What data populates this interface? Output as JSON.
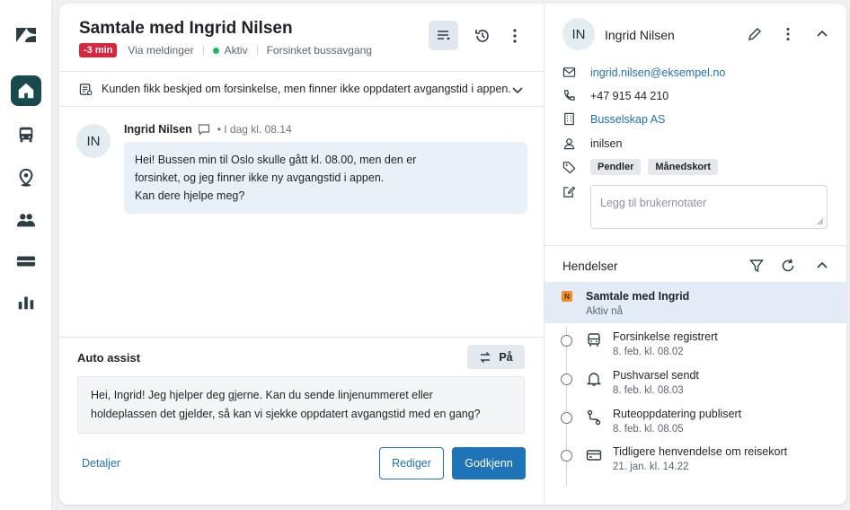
{
  "rail": {
    "logo": "zendesk-logo",
    "items": [
      {
        "icon": "home-icon",
        "active": true
      },
      {
        "icon": "bus-icon",
        "active": false
      },
      {
        "icon": "map-pin-icon",
        "active": false
      },
      {
        "icon": "users-icon",
        "active": false
      },
      {
        "icon": "ticket-icon",
        "active": false
      },
      {
        "icon": "bar-chart-icon",
        "active": false
      }
    ]
  },
  "conversation": {
    "title": "Samtale med Ingrid Nilsen",
    "sla_badge": "-3 min",
    "channel": "Via meldinger",
    "status": "Aktiv",
    "topic": "Forsinket bussavgang",
    "summary": "Kunden fikk beskjed om forsinkelse, men finner ikke oppdatert avgangstid i appen."
  },
  "message": {
    "avatar": "IN",
    "author": "Ingrid Nilsen",
    "time": "I dag kl. 08.14",
    "lines": [
      "Hei! Bussen min til Oslo skulle gått kl. 08.00, men den er",
      "forsinket, og jeg finner ikke ny avgangstid i appen.",
      "Kan dere hjelpe meg?"
    ]
  },
  "auto_assist": {
    "title": "Auto assist",
    "toggle_label": "På",
    "lines": [
      "Hei, Ingrid! Jeg hjelper deg gjerne. Kan du sende linjenummeret eller",
      "holdeplassen det gjelder, så kan vi sjekke oppdatert avgangstid med en gang?"
    ],
    "details_link": "Detaljer",
    "edit_button": "Rediger",
    "approve_button": "Godkjenn"
  },
  "customer": {
    "avatar": "IN",
    "name": "Ingrid Nilsen",
    "email": "ingrid.nilsen@eksempel.no",
    "phone": "+47 915 44 210",
    "organization": "Busselskap AS",
    "username": "inilsen",
    "tags": [
      "Pendler",
      "Månedskort"
    ],
    "notes_placeholder": "Legg til brukernotater"
  },
  "events": {
    "title": "Hendelser",
    "active": {
      "badge": "N",
      "title": "Samtale med Ingrid",
      "subtitle": "Aktiv nå"
    },
    "items": [
      {
        "icon": "bus-icon",
        "title": "Forsinkelse registrert",
        "date": "8. feb. kl. 08.02"
      },
      {
        "icon": "bell-icon",
        "title": "Pushvarsel sendt",
        "date": "8. feb. kl. 08.03"
      },
      {
        "icon": "route-icon",
        "title": "Ruteoppdatering publisert",
        "date": "8. feb. kl. 08.05"
      },
      {
        "icon": "card-icon",
        "title": "Tidligere henvendelse om reisekort",
        "date": "21. jan. kl. 14.22"
      }
    ]
  },
  "colors": {
    "primary": "#1f73b7",
    "rail_active": "#17494d",
    "sla_red": "#d7263d",
    "status_green": "#1fb85a",
    "event_badge": "#f08c21"
  }
}
